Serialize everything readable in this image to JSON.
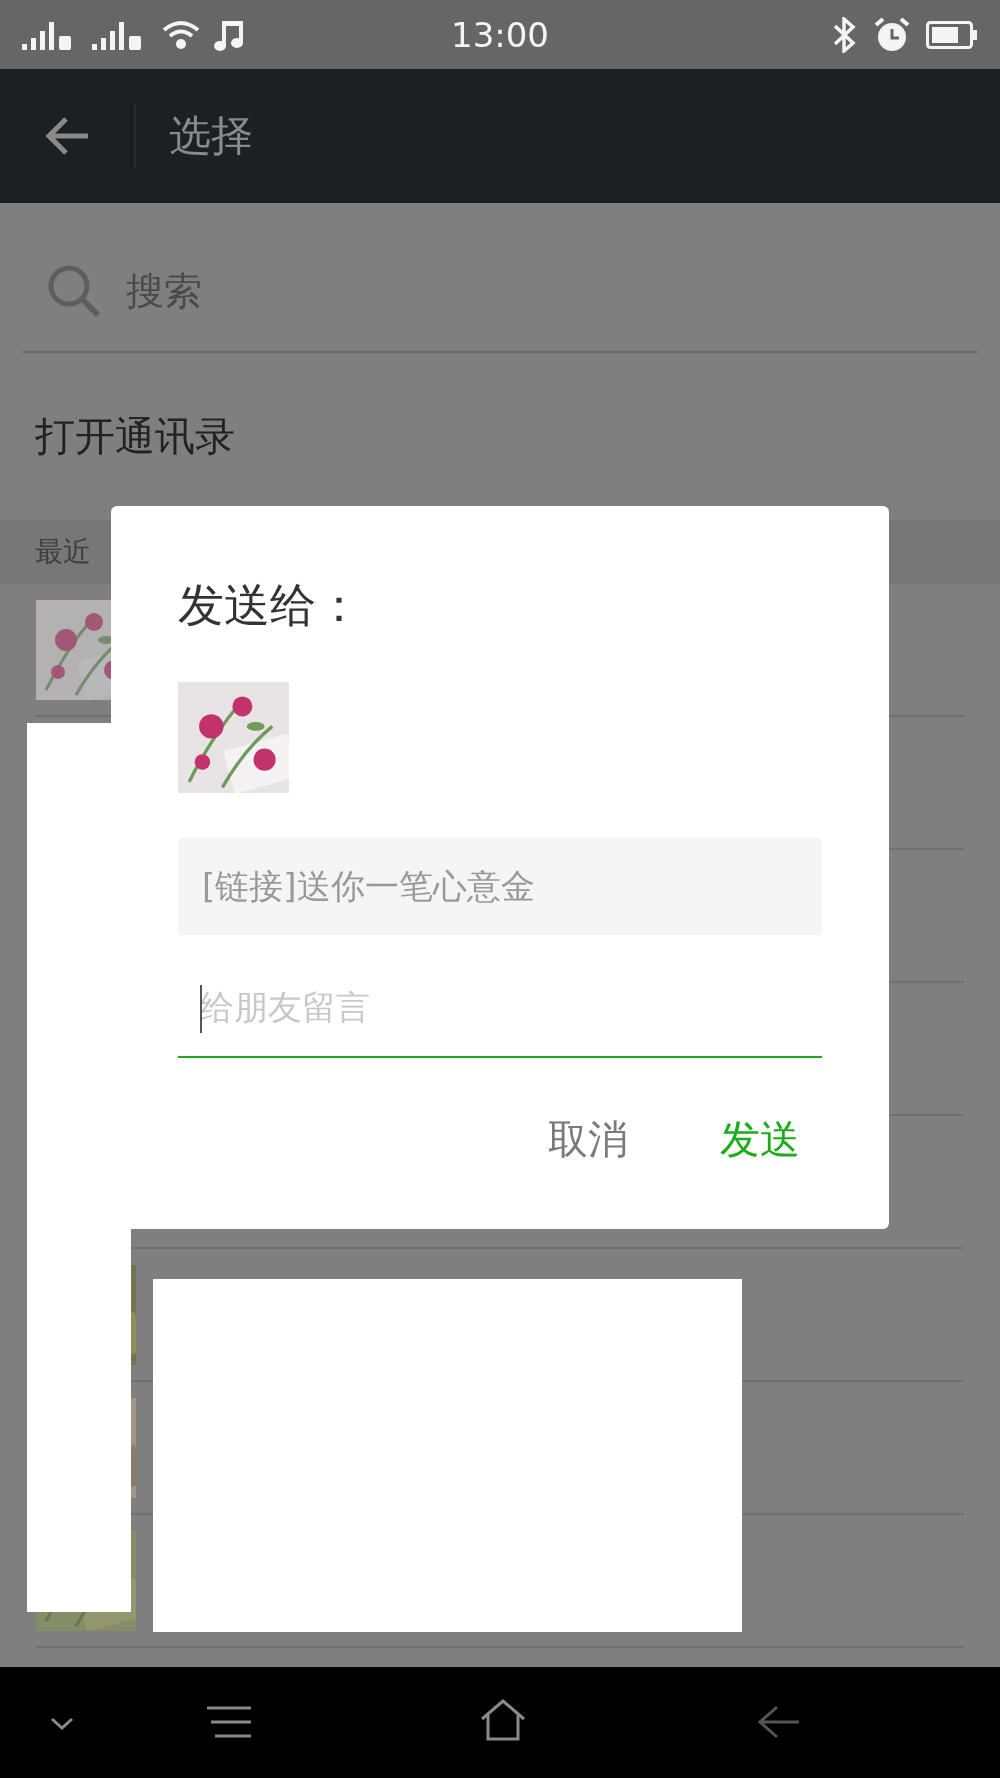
{
  "status_bar": {
    "time": "13:00"
  },
  "app_bar": {
    "title": "选择"
  },
  "search": {
    "placeholder": "搜索"
  },
  "open_contacts": "打开通讯录",
  "section_header": "最近",
  "contacts": [
    {
      "kind": "picture"
    },
    {
      "kind": "blank"
    },
    {
      "kind": "blank"
    },
    {
      "kind": "blank"
    },
    {
      "kind": "blank"
    },
    {
      "kind": "picture"
    },
    {
      "kind": "picture"
    },
    {
      "kind": "picture"
    }
  ],
  "dialog": {
    "title": "发送给：",
    "thumbnail": {
      "kind": "picture"
    },
    "link_text": "[链接]送你一笔心意金",
    "message": {
      "placeholder": "给朋友留言"
    },
    "buttons": [
      {
        "label": "取消",
        "kind": "cancel"
      },
      {
        "label": "发送",
        "kind": "primary"
      }
    ]
  }
}
